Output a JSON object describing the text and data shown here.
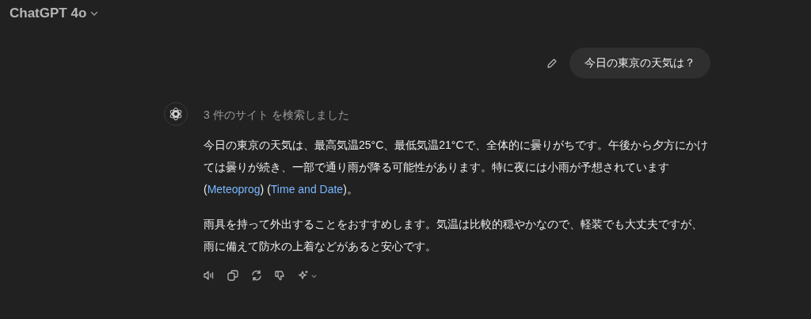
{
  "header": {
    "title": "ChatGPT 4o"
  },
  "user_message": {
    "text": "今日の東京の天気は？"
  },
  "assistant_message": {
    "search_status": "3 件のサイト を検索しました",
    "paragraphs": [
      {
        "parts": [
          {
            "kind": "text",
            "text": "今日の東京の天気は、最高気温25°C、最低気温21°Cで、全体的に曇りがちです。午後から夕方にかけては曇りが続き、一部で通り雨が降る可能性があります。特に夜には小雨が予想されています ("
          },
          {
            "kind": "link",
            "text": "Meteoprog"
          },
          {
            "kind": "text",
            "text": ") ("
          },
          {
            "kind": "link",
            "text": "Time and Date"
          },
          {
            "kind": "text",
            "text": ")。"
          }
        ]
      },
      {
        "parts": [
          {
            "kind": "text",
            "text": "雨具を持って外出することをおすすめします。気温は比較的穏やかなので、軽装でも大丈夫ですが、雨に備えて防水の上着などがあると安心です。"
          }
        ]
      }
    ]
  }
}
